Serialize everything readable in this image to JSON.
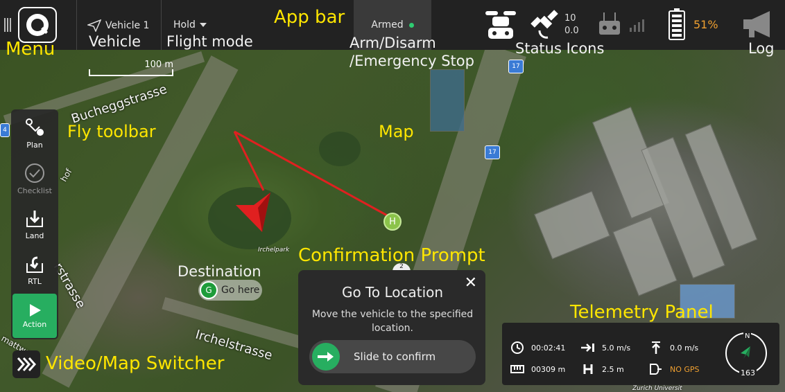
{
  "app_bar": {
    "vehicle_label": "Vehicle 1",
    "flight_mode": "Hold",
    "arm_status": "Armed",
    "gps_sat_count": "10",
    "gps_hdop": "0.0",
    "battery_percent": "51%"
  },
  "annotations": {
    "app_bar": "App bar",
    "menu": "Menu",
    "vehicle": "Vehicle",
    "flight_mode": "Flight mode",
    "arm_disarm": "Arm/Disarm",
    "emergency_stop": "/Emergency Stop",
    "status_icons": "Status Icons",
    "log": "Log",
    "fly_toolbar": "Fly toolbar",
    "map": "Map",
    "confirmation_prompt": "Confirmation Prompt",
    "destination": "Destination",
    "telemetry_panel": "Telemetry Panel",
    "video_map_switcher": "Video/Map Switcher"
  },
  "fly_toolbar": {
    "plan": "Plan",
    "checklist": "Checklist",
    "land": "Land",
    "rtl": "RTL",
    "action": "Action"
  },
  "map": {
    "scale_label": "100 m",
    "streets": {
      "bucheggstrasse": "Bucheggstrasse",
      "irchelstrasse": "Irchelstrasse",
      "strasse_left": "rstrasse",
      "mattweg": "mattwe",
      "hof": "hof"
    },
    "park_label": "Irchelpark",
    "route_badge": "17",
    "route_badge_left": "4",
    "home_marker": "H",
    "goto_marker": "G",
    "goto_label": "Go here",
    "waypoint_label": "2",
    "university_label": "Zurich Universit"
  },
  "prompt": {
    "title": "Go To Location",
    "message": "Move the vehicle to the specified location.",
    "slider_label": "Slide to confirm",
    "close_glyph": "✕"
  },
  "telemetry": {
    "flight_time": "00:02:41",
    "distance": "00309 m",
    "horizontal_speed": "5.0 m/s",
    "altitude": "2.5 m",
    "vertical_speed": "0.0 m/s",
    "gps_status": "NO GPS",
    "compass_north": "N",
    "heading": "163"
  },
  "colors": {
    "accent_green": "#27ae60",
    "annotation_yellow": "#ffe600",
    "battery_orange": "#f0a030",
    "route_red": "#e02020",
    "bar_bg": "#222222"
  }
}
